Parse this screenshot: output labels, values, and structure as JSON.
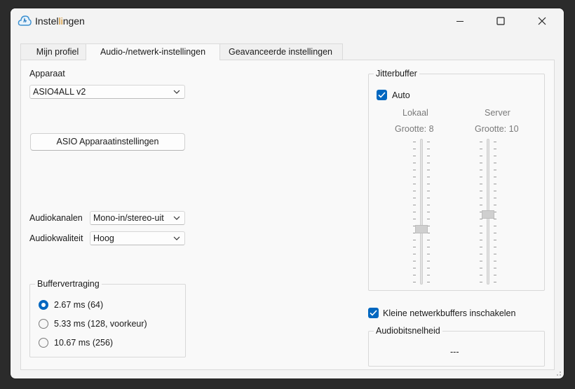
{
  "window": {
    "title_pre": "Instel",
    "title_hl": "li",
    "title_post": "ngen"
  },
  "tabs": [
    {
      "label": "Mijn profiel"
    },
    {
      "label": "Audio-/netwerk-instellingen"
    },
    {
      "label": "Geavanceerde instellingen"
    }
  ],
  "device": {
    "label": "Apparaat",
    "value": "ASIO4ALL v2",
    "button": "ASIO Apparaatinstellingen"
  },
  "channels": {
    "label": "Audiokanalen",
    "value": "Mono-in/stereo-uit"
  },
  "quality": {
    "label": "Audiokwaliteit",
    "value": "Hoog"
  },
  "buffer": {
    "title": "Buffervertraging",
    "options": [
      {
        "label": "2.67 ms (64)",
        "selected": true
      },
      {
        "label": "5.33 ms (128, voorkeur)",
        "selected": false
      },
      {
        "label": "10.67 ms (256)",
        "selected": false
      }
    ]
  },
  "jitter": {
    "title": "Jitterbuffer",
    "auto_label": "Auto",
    "auto_checked": true,
    "local": {
      "label": "Lokaal",
      "size": "Grootte: 8",
      "value": 8
    },
    "server": {
      "label": "Server",
      "size": "Grootte: 10",
      "value": 10
    }
  },
  "small_buffers": {
    "label": "Kleine netwerkbuffers inschakelen",
    "checked": true
  },
  "bitrate": {
    "title": "Audiobitsnelheid",
    "value": "---"
  },
  "colors": {
    "accent": "#0067c0",
    "window_bg": "#f3f3f3"
  }
}
